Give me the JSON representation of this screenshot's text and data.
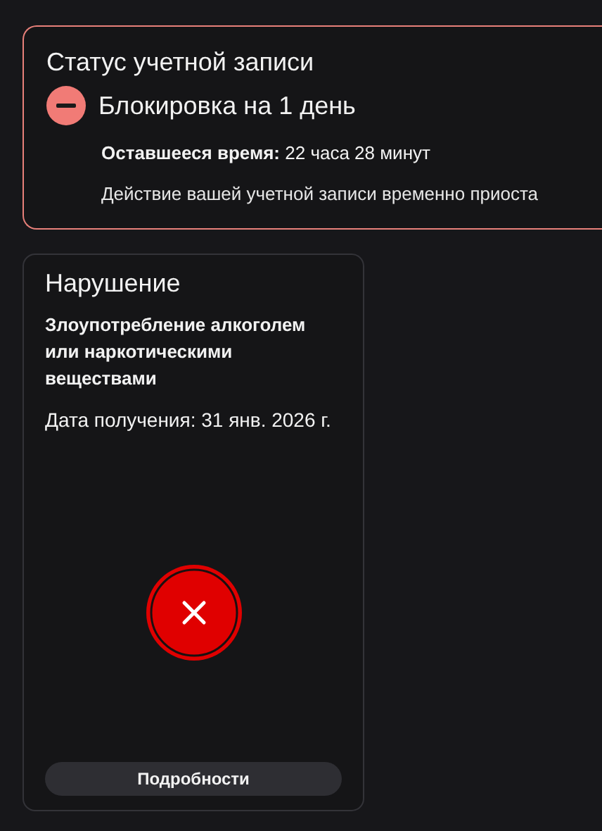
{
  "account_status": {
    "title": "Статус учетной записи",
    "block_label": "Блокировка на 1 день",
    "remaining": "**Оставшееся время:** 22 часа 28 минут",
    "description": "Действие вашей учетной записи временно приоста"
  },
  "violation": {
    "title": "Нарушение",
    "reason": "Злоупотребление алкоголем или наркотическими веществами",
    "date": "Дата получения: 31 янв. 2026 г.",
    "details_button": "Подробности"
  }
}
